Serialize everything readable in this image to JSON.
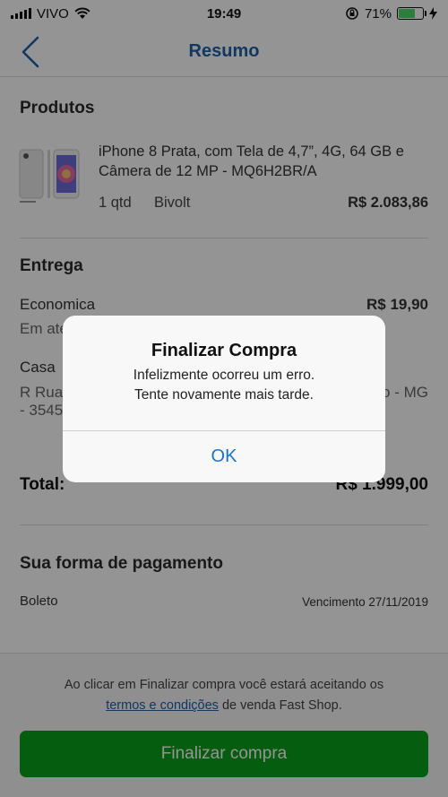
{
  "status_bar": {
    "carrier": "VIVO",
    "time": "19:49",
    "battery_percent": "71%",
    "battery_level": 0.71
  },
  "nav": {
    "title": "Resumo"
  },
  "products": {
    "title": "Produtos",
    "item": {
      "name": "iPhone 8 Prata, com Tela de 4,7”, 4G, 64 GB e Câmera de 12 MP - MQ6H2BR/A",
      "qty": "1 qtd",
      "voltage": "Bivolt",
      "price": "R$ 2.083,86"
    }
  },
  "delivery": {
    "title": "Entrega",
    "method": "Economica",
    "method_price": "R$ 19,90",
    "eta_partial": "Em ate",
    "address_label": "Casa",
    "address_line1_partial": "R Rua",
    "address_line1_right": "o - MG",
    "address_line2_partial": "- 3545"
  },
  "total": {
    "label": "Total:",
    "value": "R$ 1.999,00"
  },
  "payment": {
    "title": "Sua forma de pagamento",
    "method": "Boleto",
    "due": "Vencimento 27/11/2019"
  },
  "footer": {
    "terms_prefix": "Ao clicar em Finalizar compra você estará aceitando os",
    "terms_link": "termos e condições",
    "terms_suffix": " de venda Fast Shop.",
    "finalize_label": "Finalizar compra",
    "finalize_color": "#0aa11a"
  },
  "alert": {
    "title": "Finalizar Compra",
    "message_line1": "Infelizmente ocorreu um erro.",
    "message_line2": "Tente novamente mais tarde.",
    "ok_label": "OK"
  },
  "colors": {
    "accent": "#1f5fa8",
    "alert_button": "#1a73c8"
  }
}
